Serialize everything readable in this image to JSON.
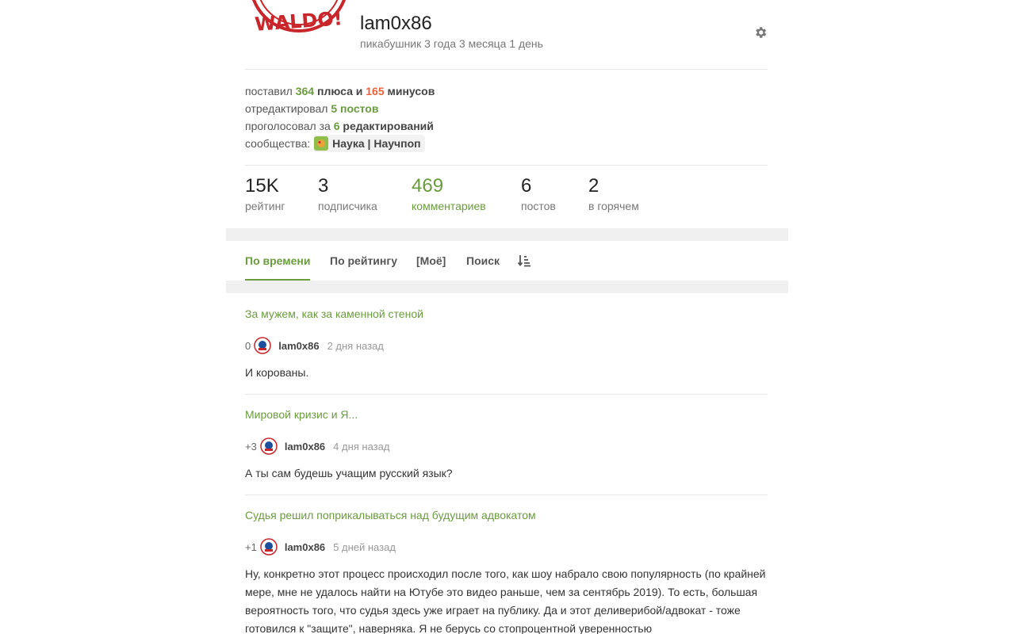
{
  "profile": {
    "username": "lam0x86",
    "age_text": "пикабушник 3 года 3 месяца 1 день",
    "avatar_text": "WALDO!"
  },
  "summary": {
    "votes_prefix": "поставил",
    "pluses": "364",
    "pluses_word": "плюса",
    "and_word": "и",
    "minuses": "165",
    "minuses_word": "минусов",
    "edited_prefix": "отредактировал",
    "edited_value": "5 постов",
    "voted_prefix": "проголосовал за",
    "voted_value": "6",
    "voted_suffix": "редактирований",
    "communities_prefix": "сообщества:",
    "community_name": "Наука | Научпоп"
  },
  "stats": [
    {
      "value": "15K",
      "label": "рейтинг"
    },
    {
      "value": "3",
      "label": "подписчика"
    },
    {
      "value": "469",
      "label": "комментариев"
    },
    {
      "value": "6",
      "label": "постов"
    },
    {
      "value": "2",
      "label": "в горячем"
    }
  ],
  "tabs": [
    "По времени",
    "По рейтингу",
    "[Моё]",
    "Поиск"
  ],
  "comments": [
    {
      "title": "За мужем, как за каменной стеной",
      "rating": "0",
      "user": "lam0x86",
      "time": "2 дня назад",
      "text": "И корованы."
    },
    {
      "title": "Мировой кризис и Я...",
      "rating": "+3",
      "user": "lam0x86",
      "time": "4 дня назад",
      "text": "А ты сам будешь учащим русский язык?"
    },
    {
      "title": "Судья решил поприкалываться над будущим адвокатом",
      "rating": "+1",
      "user": "lam0x86",
      "time": "5 дней назад",
      "text": "Ну, конкретно этот процесс происходил после того, как шоу набрало свою популярность (по крайней мере, мне не удалось найти на Ютубе это видео раньше, чем за сентябрь 2019). То есть, большая вероятность того, что судья здесь уже играет на публику. Да и этот деливерибой/адвокат - тоже готовился к \"защите\", наверняка. Я не берусь со стопроцентной уверенностью"
    }
  ],
  "colors": {
    "accent_green": "#6a9c3d",
    "minus_orange": "#e8623b",
    "band_gray": "#f0f0f0"
  }
}
